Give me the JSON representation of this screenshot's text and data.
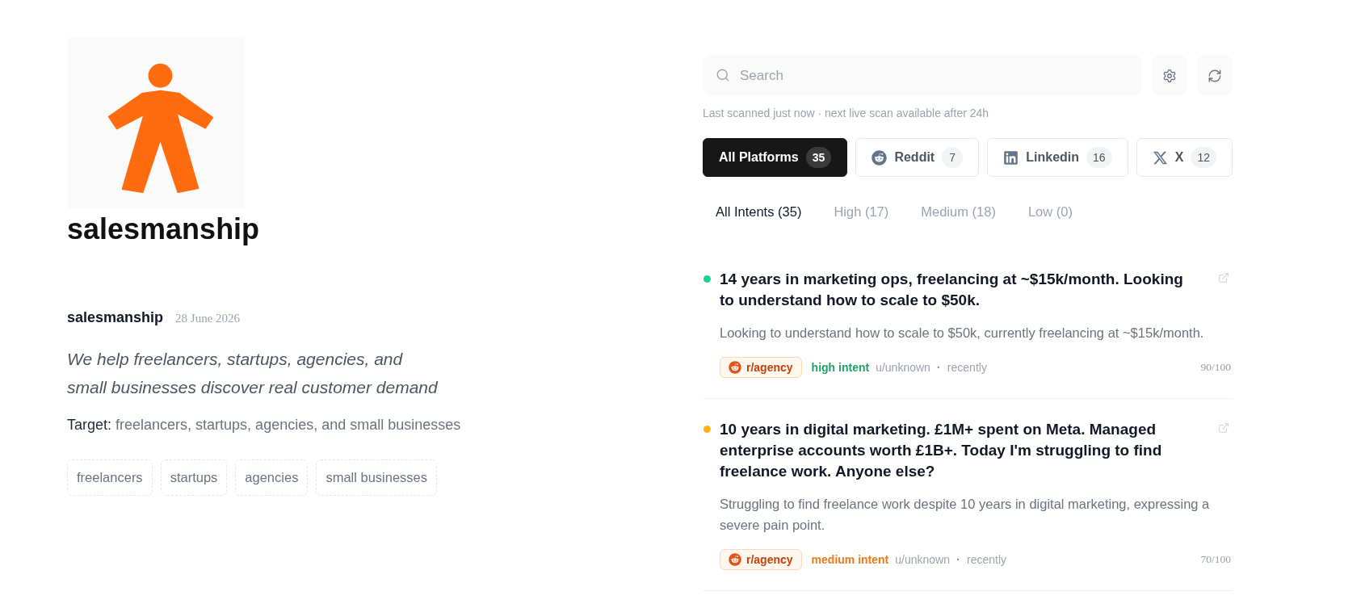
{
  "profile": {
    "title": "salesmanship",
    "name": "salesmanship",
    "date": "28 June 2026",
    "tagline": "We help freelancers, startups, agencies, and small businesses discover real customer demand",
    "target": {
      "label": "Target:",
      "value": "freelancers, startups, agencies, and small businesses"
    },
    "tags": [
      "freelancers",
      "startups",
      "agencies",
      "small businesses"
    ]
  },
  "search": {
    "placeholder": "Search"
  },
  "scan_status": "Last scanned just now · next live scan available after 24h",
  "platform_tabs": [
    {
      "kind": "all",
      "label": "All Platforms",
      "count": "35",
      "selected": true
    },
    {
      "kind": "reddit",
      "label": "Reddit",
      "count": "7",
      "selected": false
    },
    {
      "kind": "linkedin",
      "label": "Linkedin",
      "count": "16",
      "selected": false
    },
    {
      "kind": "x",
      "label": "X",
      "count": "12",
      "selected": false
    }
  ],
  "intent_tabs": [
    {
      "label": "All Intents (35)",
      "selected": true
    },
    {
      "label": "High (17)",
      "selected": false
    },
    {
      "label": "Medium (18)",
      "selected": false
    },
    {
      "label": "Low (0)",
      "selected": false
    }
  ],
  "posts": [
    {
      "color": "#17d38b",
      "title": "14 years in marketing ops, freelancing at ~$15k/month. Looking to understand how to scale to $50k.",
      "summary": "Looking to understand how to scale to $50k, currently freelancing at ~$15k/month.",
      "subreddit": "r/agency",
      "intent": {
        "label": "high intent",
        "color": "#22a06b"
      },
      "author": "u/unknown",
      "separator": "·",
      "time": "recently",
      "score": "90/100"
    },
    {
      "color": "#fbb614",
      "title": "10 years in digital marketing. £1M+ spent on Meta. Managed enterprise accounts worth £1B+. Today I'm struggling to find freelance work. Anyone else?",
      "summary": "Struggling to find freelance work despite 10 years in digital marketing, expressing a severe pain point.",
      "subreddit": "r/agency",
      "intent": {
        "label": "medium intent",
        "color": "#ea7b17"
      },
      "author": "u/unknown",
      "separator": "·",
      "time": "recently",
      "score": "70/100"
    }
  ]
}
